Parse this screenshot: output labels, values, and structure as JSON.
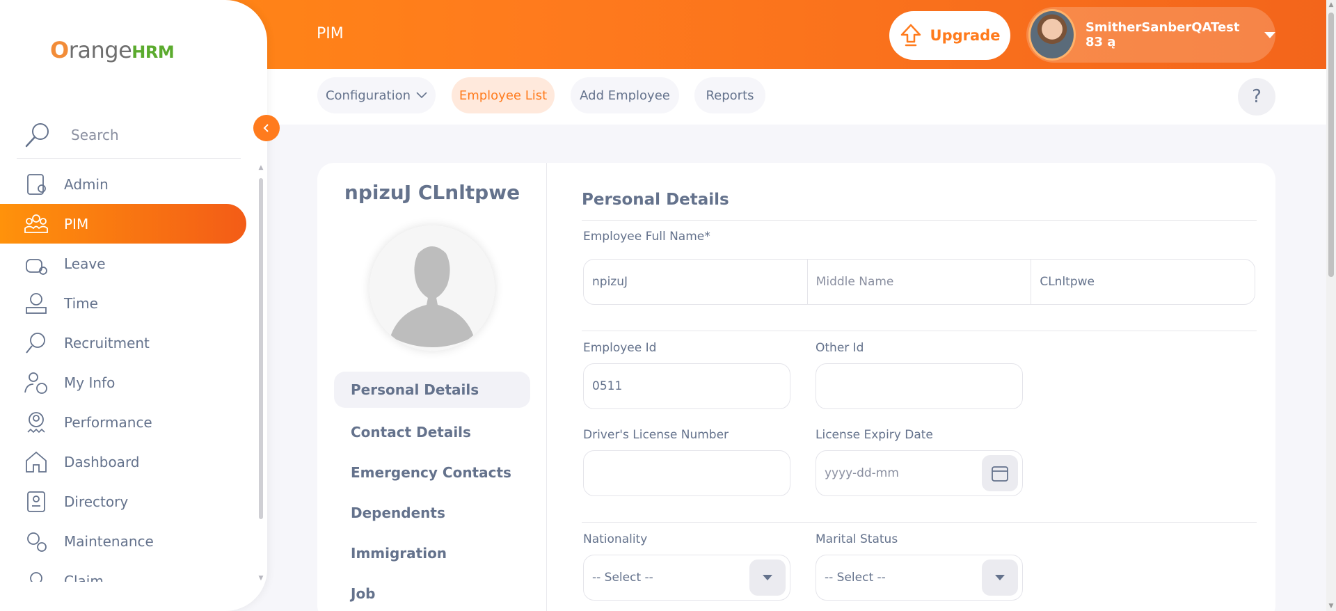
{
  "brand": {
    "o": "O",
    "range": "range",
    "hrm": "HRM"
  },
  "sidebar": {
    "search_label": "Search",
    "items": [
      {
        "label": "Admin",
        "icon": "admin-icon"
      },
      {
        "label": "PIM",
        "icon": "pim-icon",
        "active": true
      },
      {
        "label": "Leave",
        "icon": "leave-icon"
      },
      {
        "label": "Time",
        "icon": "time-icon"
      },
      {
        "label": "Recruitment",
        "icon": "recruitment-icon"
      },
      {
        "label": "My Info",
        "icon": "my-info-icon"
      },
      {
        "label": "Performance",
        "icon": "performance-icon"
      },
      {
        "label": "Dashboard",
        "icon": "dashboard-icon"
      },
      {
        "label": "Directory",
        "icon": "directory-icon"
      },
      {
        "label": "Maintenance",
        "icon": "maintenance-icon"
      },
      {
        "label": "Claim",
        "icon": "claim-icon"
      }
    ]
  },
  "header": {
    "title": "PIM",
    "upgrade_label": "Upgrade",
    "user_name": "SmitherSanberQATest 83 ą"
  },
  "subnav": {
    "tabs": [
      {
        "label": "Configuration",
        "has_dropdown": true
      },
      {
        "label": "Employee List",
        "active": true
      },
      {
        "label": "Add Employee"
      },
      {
        "label": "Reports"
      }
    ],
    "help_label": "?"
  },
  "employee": {
    "name": "npizuJ CLnltpwe",
    "tabs": [
      "Personal Details",
      "Contact Details",
      "Emergency Contacts",
      "Dependents",
      "Immigration",
      "Job"
    ]
  },
  "form": {
    "section_title": "Personal Details",
    "full_name_label": "Employee Full Name*",
    "first_name": "npizuJ",
    "middle_name_placeholder": "Middle Name",
    "last_name": "CLnltpwe",
    "employee_id_label": "Employee Id",
    "employee_id": "0511",
    "other_id_label": "Other Id",
    "other_id": "",
    "license_label": "Driver's License Number",
    "license_value": "",
    "license_expiry_label": "License Expiry Date",
    "license_expiry_placeholder": "yyyy-dd-mm",
    "nationality_label": "Nationality",
    "nationality_value": "-- Select --",
    "marital_label": "Marital Status",
    "marital_value": "-- Select --"
  },
  "colors": {
    "accent": "#ff7b1d",
    "text": "#64728c",
    "active_tab_bg": "#ffe9dc"
  }
}
